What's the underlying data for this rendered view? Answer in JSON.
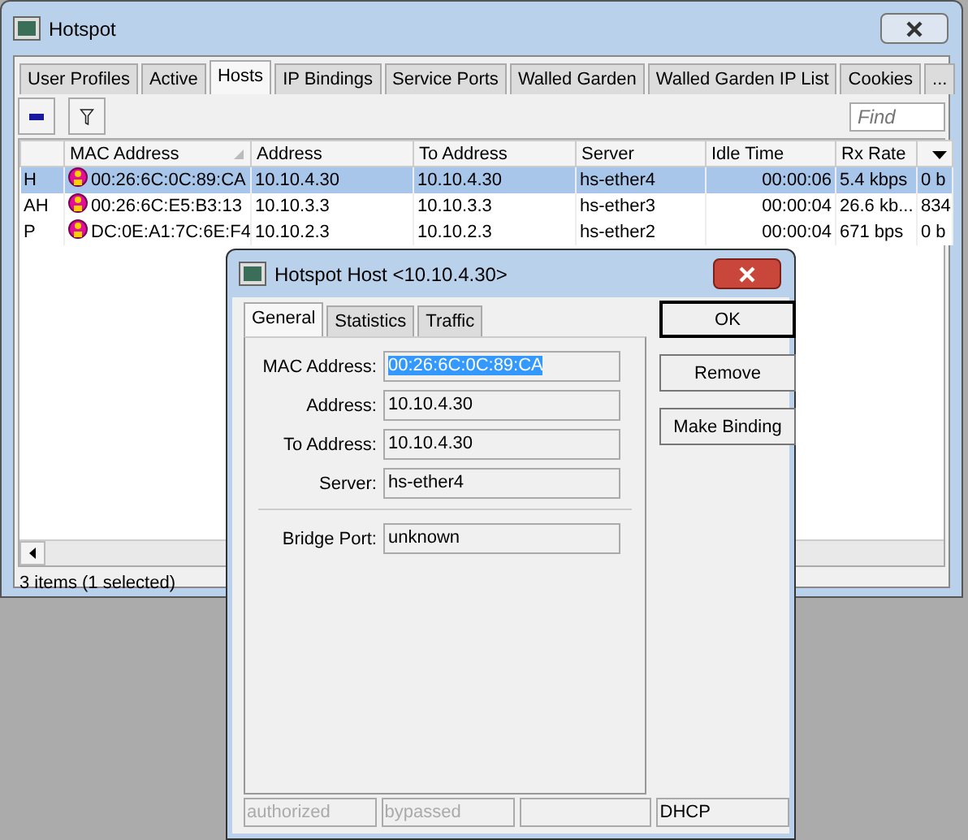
{
  "main_window": {
    "title": "Hotspot",
    "tabs": [
      {
        "label": "User Profiles",
        "selected": false
      },
      {
        "label": "Active",
        "selected": false
      },
      {
        "label": "Hosts",
        "selected": true
      },
      {
        "label": "IP Bindings",
        "selected": false
      },
      {
        "label": "Service Ports",
        "selected": false
      },
      {
        "label": "Walled Garden",
        "selected": false
      },
      {
        "label": "Walled Garden IP List",
        "selected": false
      },
      {
        "label": "Cookies",
        "selected": false
      },
      {
        "label": "...",
        "selected": false
      }
    ],
    "search": {
      "placeholder": "Find"
    },
    "table": {
      "columns": [
        "",
        "MAC Address",
        "Address",
        "To Address",
        "Server",
        "Idle Time",
        "Rx Rate",
        ""
      ],
      "rows": [
        {
          "selected": true,
          "cells": [
            "H",
            "00:26:6C:0C:89:CA",
            "10.10.4.30",
            "10.10.4.30",
            "hs-ether4",
            "00:00:06",
            "5.4 kbps",
            "0 b"
          ]
        },
        {
          "selected": false,
          "cells": [
            "AH",
            "00:26:6C:E5:B3:13",
            "10.10.3.3",
            "10.10.3.3",
            "hs-ether3",
            "00:00:04",
            "26.6 kb...",
            "834"
          ]
        },
        {
          "selected": false,
          "cells": [
            "P",
            "DC:0E:A1:7C:6E:F4",
            "10.10.2.3",
            "10.10.2.3",
            "hs-ether2",
            "00:00:04",
            "671 bps",
            "0 b"
          ]
        }
      ]
    },
    "status_bar": "3 items (1 selected)"
  },
  "dialog": {
    "title": "Hotspot Host <10.10.4.30>",
    "tabs": [
      {
        "label": "General",
        "selected": true
      },
      {
        "label": "Statistics",
        "selected": false
      },
      {
        "label": "Traffic",
        "selected": false
      }
    ],
    "fields": [
      {
        "label": "MAC Address:",
        "value": "00:26:6C:0C:89:CA",
        "selected": true
      },
      {
        "label": "Address:",
        "value": "10.10.4.30",
        "selected": false
      },
      {
        "label": "To Address:",
        "value": "10.10.4.30",
        "selected": false
      },
      {
        "label": "Server:",
        "value": "hs-ether4",
        "selected": false
      },
      {
        "label": "Bridge Port:",
        "value": "unknown",
        "selected": false
      }
    ],
    "buttons": [
      "OK",
      "Remove",
      "Make Binding"
    ],
    "status": [
      {
        "text": "authorized",
        "on": false
      },
      {
        "text": "bypassed",
        "on": false
      },
      {
        "text": "DHCP",
        "on": true
      }
    ]
  }
}
